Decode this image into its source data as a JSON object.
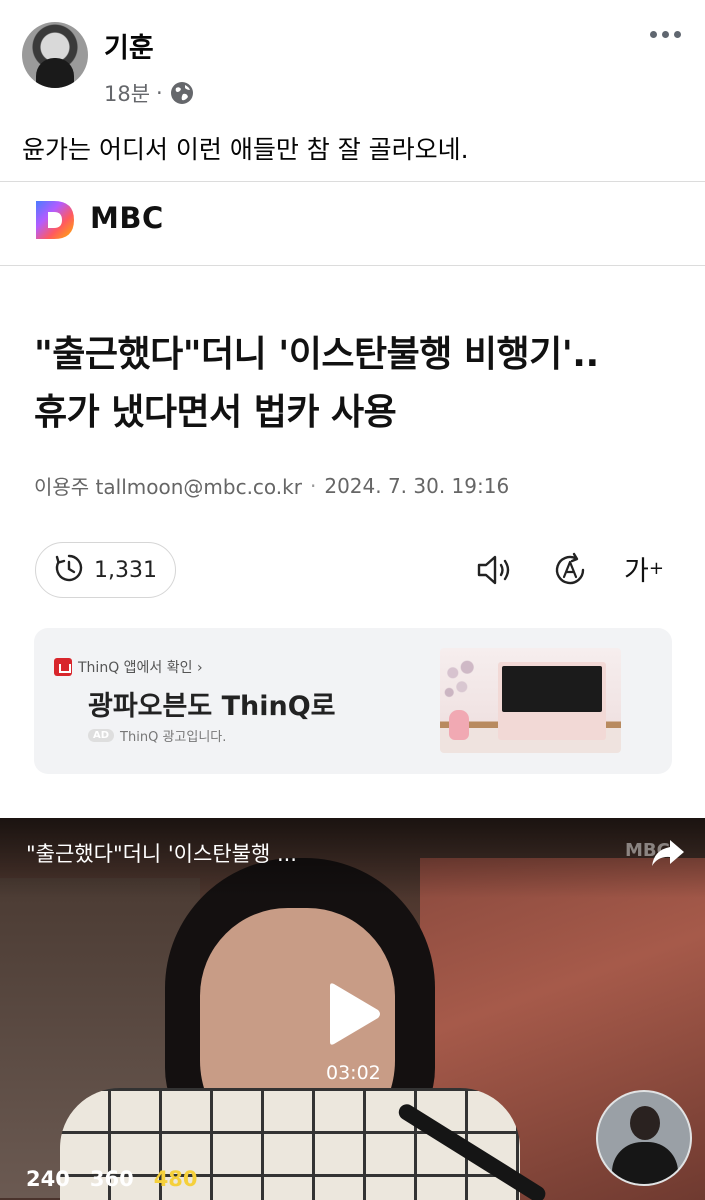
{
  "post": {
    "author": "기훈",
    "time": "18분",
    "separator": "·",
    "text": "윤가는 어디서 이런 애들만 참 잘 골라오네."
  },
  "source": {
    "name": "MBC"
  },
  "article": {
    "headline_line1": "\"출근했다\"더니 '이스탄불행 비행기'..",
    "headline_line2": "휴가 냈다면서 법카 사용",
    "reporter": "이용주 tallmoon@mbc.co.kr",
    "dot": "·",
    "date": "2024. 7. 30. 19:16",
    "views": "1,331",
    "font_size_label": "가",
    "font_size_plus": "+"
  },
  "ad": {
    "top_text": "ThinQ 앱에서 확인 ›",
    "title": "광파오븐도 ThinQ로",
    "badge": "AD",
    "sub_text": "ThinQ 광고입니다."
  },
  "video": {
    "title": "\"출근했다\"더니 '이스탄불행 ...",
    "watermark": "MBC",
    "duration": "03:02",
    "qualities": [
      "240",
      "360",
      "480"
    ],
    "selected_quality": "480"
  },
  "colors": {
    "meta_gray": "#65676b",
    "selected_quality": "#f5d03b",
    "thinq_red": "#d8262c"
  }
}
